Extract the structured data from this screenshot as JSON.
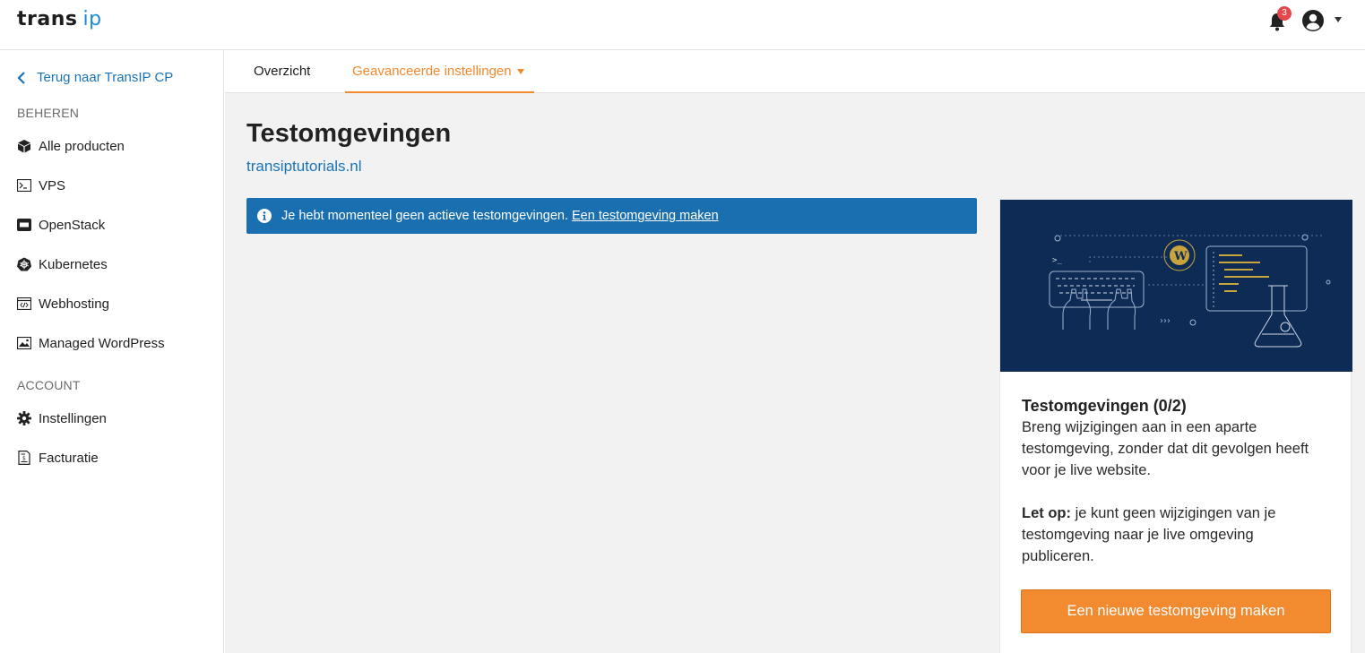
{
  "header": {
    "logo_part1": "trans",
    "logo_part2": "ip",
    "notification_count": "3"
  },
  "sidebar": {
    "back_label": "Terug naar TransIP CP",
    "section_manage": "BEHEREN",
    "manage_items": [
      {
        "label": "Alle producten",
        "icon": "cube-icon"
      },
      {
        "label": "VPS",
        "icon": "terminal-icon"
      },
      {
        "label": "OpenStack",
        "icon": "openstack-icon"
      },
      {
        "label": "Kubernetes",
        "icon": "kubernetes-icon"
      },
      {
        "label": "Webhosting",
        "icon": "webhosting-icon"
      },
      {
        "label": "Managed WordPress",
        "icon": "image-icon"
      }
    ],
    "section_account": "ACCOUNT",
    "account_items": [
      {
        "label": "Instellingen",
        "icon": "gear-icon"
      },
      {
        "label": "Facturatie",
        "icon": "invoice-icon"
      }
    ]
  },
  "tabs": {
    "overview": "Overzicht",
    "advanced": "Geavanceerde instellingen"
  },
  "page": {
    "title": "Testomgevingen",
    "domain": "transiptutorials.nl"
  },
  "alert": {
    "text": "Je hebt momenteel geen actieve testomgevingen.",
    "link": "Een testomgeving maken"
  },
  "card": {
    "title": "Testomgevingen (0/2)",
    "text1": "Breng wijzigingen aan in een aparte testomgeving, zonder dat dit gevolgen heeft voor je live website.",
    "note_label": "Let op:",
    "note_text": " je kunt geen wijzigingen van je testomgeving naar je live omgeving publiceren.",
    "button": "Een nieuwe testomgeving maken"
  },
  "colors": {
    "brand_blue": "#1a73b8",
    "accent_orange": "#ef8a2e",
    "alert_blue": "#1a6fb0",
    "illustration_bg": "#0e2b55"
  }
}
